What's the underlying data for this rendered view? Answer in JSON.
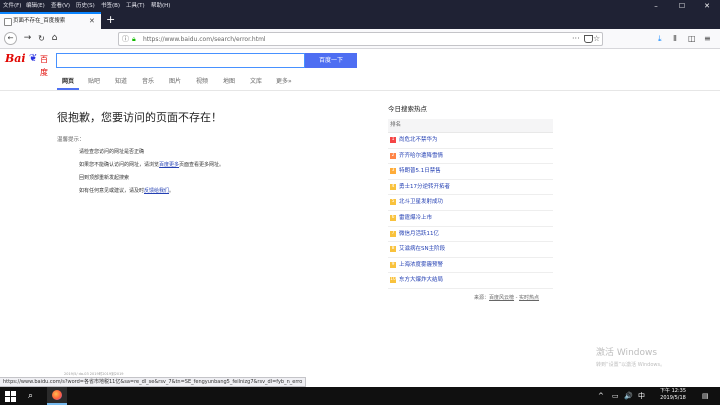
{
  "window": {
    "menus": [
      "文件(F)",
      "编辑(E)",
      "查看(V)",
      "历史(S)",
      "书签(B)",
      "工具(T)",
      "帮助(H)"
    ],
    "controls": {
      "minimize": "–",
      "maximize": "☐",
      "close": "✕"
    }
  },
  "tab": {
    "title": "页面不存在_百度搜索",
    "close": "✕",
    "new_tab": "+"
  },
  "navigation": {
    "url": "https://www.baidu.com/search/error.html",
    "back": "←",
    "forward": "→",
    "reload": "C",
    "home": "⌂",
    "more": "···",
    "star": "☆"
  },
  "toolbar_icons": [
    "download-icon",
    "library-icon",
    "sidebar-icon",
    "menu-icon"
  ],
  "baidu": {
    "logo_bai": "Bai",
    "logo_du": "百度",
    "search_value": "",
    "search_button": "百度一下",
    "tabs": [
      "网页",
      "贴吧",
      "知道",
      "音乐",
      "图片",
      "视频",
      "地图",
      "文库",
      "更多»"
    ],
    "active_tab": "网页"
  },
  "error": {
    "title": "很抱歉，您要访问的页面不存在！",
    "tips_heading": "温馨提示：",
    "tips": [
      {
        "text": "请检查您访问的网址是否正确"
      },
      {
        "before": "如果您不能确认访问的网址，请浏览",
        "link": "百度更多",
        "after": "页面查看更多网址。"
      },
      {
        "text": "回到顶部重新发起搜索"
      },
      {
        "before": "如有任何意见或建议，请及时",
        "link": "反馈给我们",
        "after": "。"
      }
    ]
  },
  "hot": {
    "title": "今日搜索热点",
    "rank_label": "排名",
    "items": [
      {
        "rank": "1",
        "text": "尚危北不禁华为",
        "color": "#f54545"
      },
      {
        "rank": "2",
        "text": "齐齐哈尔遭降雪情",
        "color": "#ff8547"
      },
      {
        "rank": "3",
        "text": "特朗普5.1日禁售",
        "color": "#ffac38"
      },
      {
        "rank": "4",
        "text": "勇士17分逆转开拓者",
        "color": "#f9c23c"
      },
      {
        "rank": "5",
        "text": "北斗卫星发射成功",
        "color": "#f9c23c"
      },
      {
        "rank": "6",
        "text": "雷霆爆冷上市",
        "color": "#f9c23c"
      },
      {
        "rank": "7",
        "text": "微信月活跃11亿",
        "color": "#f9c23c"
      },
      {
        "rank": "8",
        "text": "艾滋病在SN主阶段",
        "color": "#f9c23c"
      },
      {
        "rank": "9",
        "text": "上海浓度雾霾预警",
        "color": "#f9c23c"
      },
      {
        "rank": "10",
        "text": "东方大爆炸大结局",
        "color": "#f9c23c"
      }
    ],
    "source_prefix": "来源：",
    "source_link_1": "百度风云榜",
    "source_sep": " - ",
    "source_link_2": "实时热点"
  },
  "faint_line": "2019/5/  da-03  2019时2019到2019",
  "status_url": "https://www.baidu.com/s?word=各省市地税11亿&sa=re_dl_se&rsv_7&tn=SE_fengyunbang5_feilnizg7&rsv_dl=fyb_n_erro",
  "watermark": {
    "title": "激活 Windows",
    "subtitle": "转到“设置”以激活 Windows。"
  },
  "taskbar": {
    "search": "⌕",
    "time": "下午 12:35",
    "date": "2019/5/18",
    "tray": [
      "^",
      "▭",
      "🔊",
      "中",
      "▤"
    ]
  }
}
